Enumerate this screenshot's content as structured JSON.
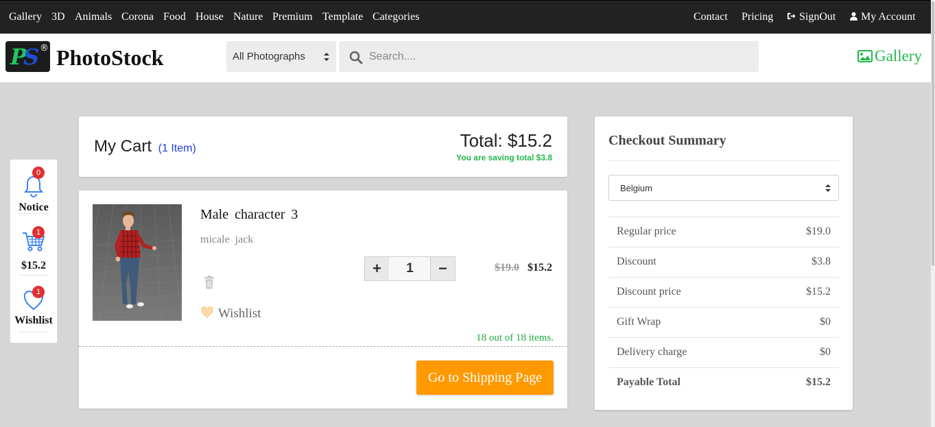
{
  "nav": {
    "left": [
      "Gallery",
      "3D",
      "Animals",
      "Corona",
      "Food",
      "House",
      "Nature",
      "Premium",
      "Template",
      "Categories"
    ],
    "contact": "Contact",
    "pricing": "Pricing",
    "signout": "SignOut",
    "account": "My Account"
  },
  "header": {
    "logo_p": "P",
    "logo_s": "S",
    "logo_r": "®",
    "brand": "PhotoStock",
    "category_select": "All Photographs",
    "search_placeholder": "Search....",
    "gallery_link": "Gallery"
  },
  "side": {
    "notice_count": "0",
    "notice_label": "Notice",
    "cart_count": "1",
    "cart_total": "$15.2",
    "wishlist_count": "1",
    "wishlist_label": "Wishlist"
  },
  "cart": {
    "title": "My Cart",
    "count_label": "(1 Item)",
    "total_label": "Total: $15.2",
    "saving_label": "You are saving total $3.8"
  },
  "item": {
    "title": "Male character 3",
    "author": "micale jack",
    "wishlist_label": "Wishlist",
    "plus": "+",
    "quantity": "1",
    "minus": "−",
    "old_price": "$19.0",
    "new_price": "$15.2",
    "stock": "18 out of 18 items.",
    "shipping_button": "Go to Shipping Page"
  },
  "summary": {
    "title": "Checkout Summary",
    "country": "Belgium",
    "rows": [
      {
        "label": "Regular price",
        "value": "$19.0"
      },
      {
        "label": "Discount",
        "value": "$3.8"
      },
      {
        "label": "Discount price",
        "value": "$15.2"
      },
      {
        "label": "Gift Wrap",
        "value": "$0"
      },
      {
        "label": "Delivery charge",
        "value": "$0"
      }
    ],
    "payable_label": "Payable Total",
    "payable_value": "$15.2"
  },
  "colors": {
    "nav_bg": "#222222",
    "accent_green": "#22b84b",
    "button_orange": "#ff9900",
    "badge_red": "#e03131",
    "link_blue": "#1d3fd8"
  },
  "icons": [
    "bell-icon",
    "cart-icon",
    "heart-icon",
    "search-icon",
    "image-icon",
    "trash-icon",
    "signout-icon",
    "user-icon"
  ]
}
